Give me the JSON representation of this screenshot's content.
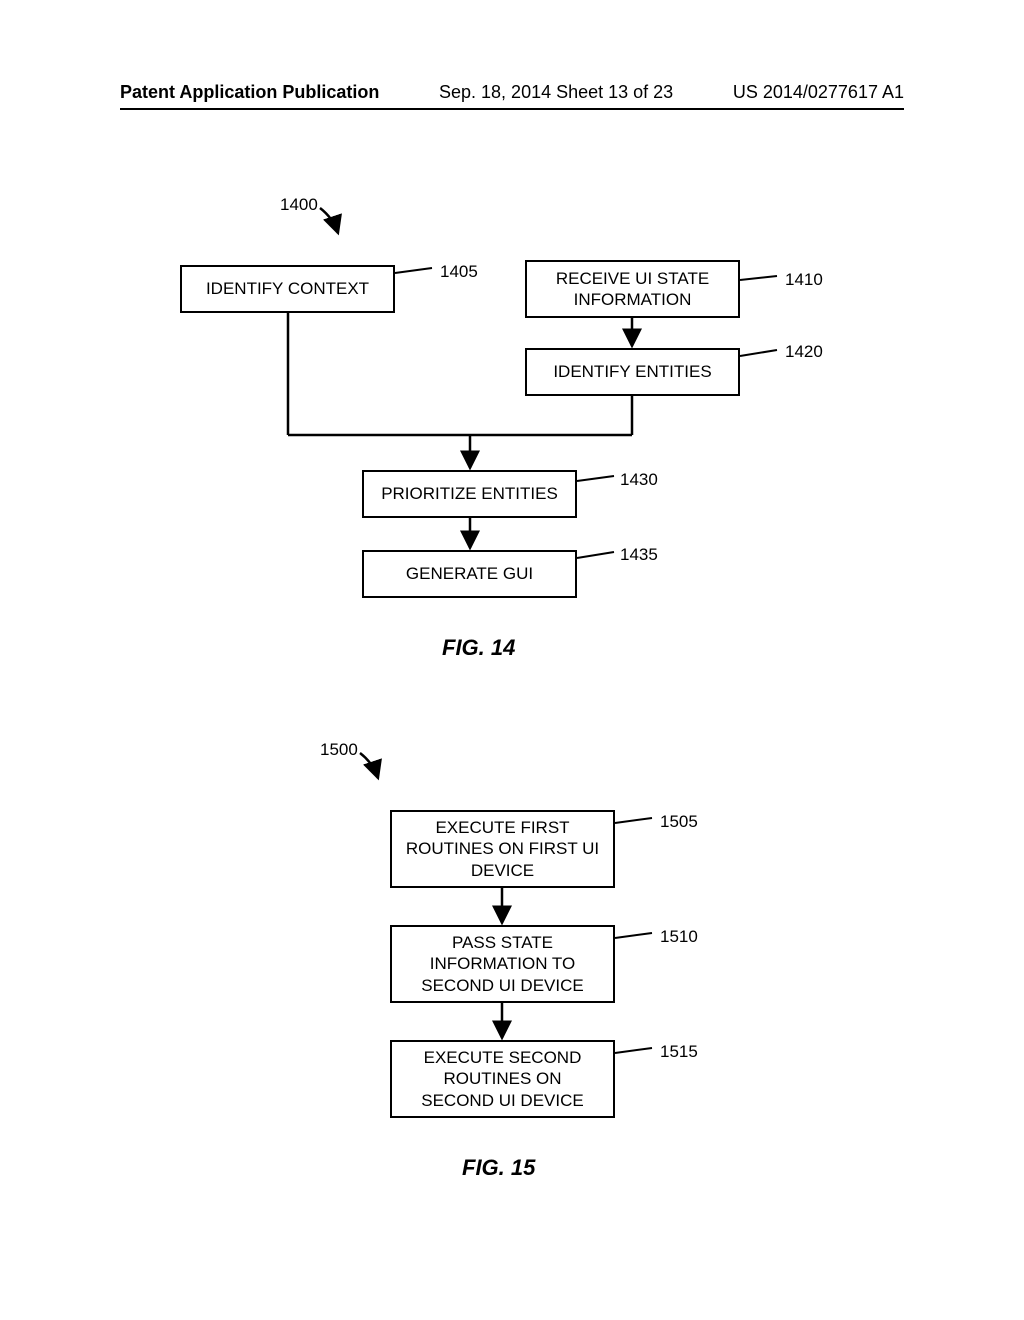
{
  "header": {
    "pub_type": "Patent Application Publication",
    "date_sheet": "Sep. 18, 2014  Sheet 13 of 23",
    "pub_number": "US 2014/0277617 A1"
  },
  "fig14": {
    "ref": "1400",
    "title": "FIG. 14",
    "boxes": {
      "b1405": {
        "text": "IDENTIFY CONTEXT",
        "ref": "1405"
      },
      "b1410": {
        "text": "RECEIVE UI STATE\nINFORMATION",
        "ref": "1410"
      },
      "b1420": {
        "text": "IDENTIFY ENTITIES",
        "ref": "1420"
      },
      "b1430": {
        "text": "PRIORITIZE ENTITIES",
        "ref": "1430"
      },
      "b1435": {
        "text": "GENERATE GUI",
        "ref": "1435"
      }
    }
  },
  "fig15": {
    "ref": "1500",
    "title": "FIG. 15",
    "boxes": {
      "b1505": {
        "text": "EXECUTE FIRST\nROUTINES ON FIRST UI\nDEVICE",
        "ref": "1505"
      },
      "b1510": {
        "text": "PASS STATE\nINFORMATION TO\nSECOND UI DEVICE",
        "ref": "1510"
      },
      "b1515": {
        "text": "EXECUTE SECOND\nROUTINES ON\nSECOND UI DEVICE",
        "ref": "1515"
      }
    }
  }
}
